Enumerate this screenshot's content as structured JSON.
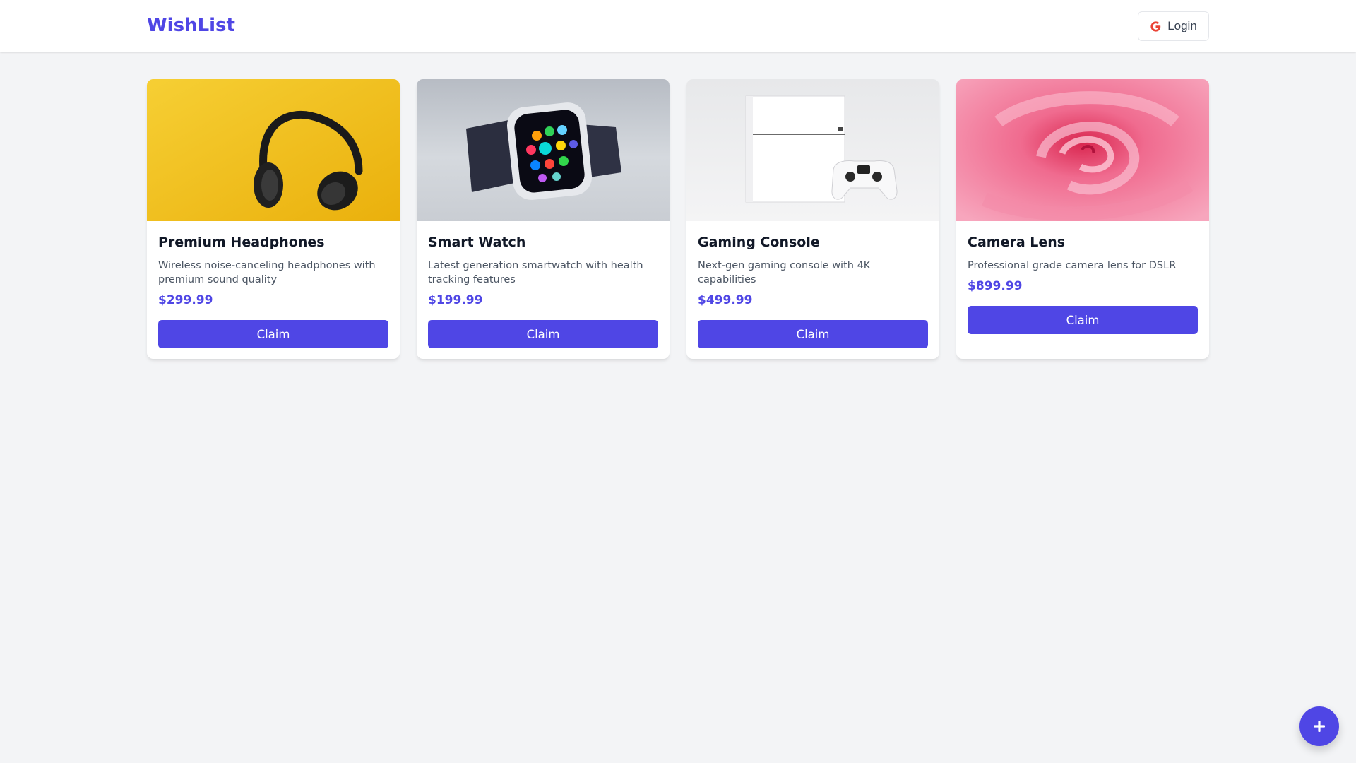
{
  "header": {
    "brand": "WishList",
    "login_label": "Login"
  },
  "items": [
    {
      "title": "Premium Headphones",
      "description": "Wireless noise-canceling headphones with premium sound quality",
      "price": "$299.99",
      "claim_label": "Claim"
    },
    {
      "title": "Smart Watch",
      "description": "Latest generation smartwatch with health tracking features",
      "price": "$199.99",
      "claim_label": "Claim"
    },
    {
      "title": "Gaming Console",
      "description": "Next-gen gaming console with 4K capabilities",
      "price": "$499.99",
      "claim_label": "Claim"
    },
    {
      "title": "Camera Lens",
      "description": "Professional grade camera lens for DSLR",
      "price": "$899.99",
      "claim_label": "Claim"
    }
  ],
  "fab": {
    "icon": "plus-icon"
  },
  "colors": {
    "accent": "#4f46e5",
    "background": "#f3f4f6"
  }
}
